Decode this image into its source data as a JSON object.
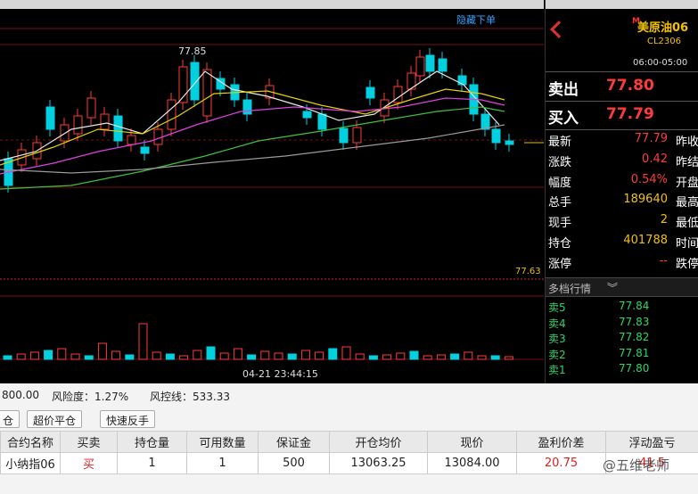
{
  "chart": {
    "hide_panel_label": "隐藏下单",
    "high_label": "77.85",
    "current_price_label": "77.63",
    "time_label": "04-21 23:44:15"
  },
  "quote": {
    "name": "美原油06",
    "code": "CL2306",
    "badge": "M",
    "session": "06:00-05:00",
    "sell_label": "卖出",
    "sell_price": "77.80",
    "buy_label": "买入",
    "buy_price": "77.79",
    "rows": [
      {
        "label": "最新",
        "value": "77.79",
        "right": "昨收",
        "color": "#ff3a3a"
      },
      {
        "label": "涨跌",
        "value": "0.42",
        "right": "昨结",
        "color": "#ff3a3a"
      },
      {
        "label": "幅度",
        "value": "0.54%",
        "right": "开盘",
        "color": "#ff3a3a"
      },
      {
        "label": "总手",
        "value": "189640",
        "right": "最高",
        "color": "#f2c200"
      },
      {
        "label": "现手",
        "value": "2",
        "right": "最低",
        "color": "#f2c200"
      },
      {
        "label": "持仓",
        "value": "401788",
        "right": "时间",
        "color": "#f2c200"
      },
      {
        "label": "涨停",
        "value": "--",
        "right": "跌停",
        "color": "#ff3a3a"
      }
    ],
    "depth_title": "多档行情",
    "depth_icon": "chevron-double-down-icon",
    "depth": [
      {
        "label": "卖5",
        "value": "77.84"
      },
      {
        "label": "卖4",
        "value": "77.83"
      },
      {
        "label": "卖3",
        "value": "77.82"
      },
      {
        "label": "卖2",
        "value": "77.81"
      },
      {
        "label": "卖1",
        "value": "77.80"
      }
    ]
  },
  "account": {
    "balance_tail": "800.00",
    "risk_label": "风险度：1.27%",
    "control_label": "风控线：533.33",
    "buttons": [
      "仓",
      "超价平仓",
      "快速反手"
    ],
    "table": {
      "headers": [
        "合约名称",
        "买卖",
        "持仓量",
        "可用数量",
        "保证金",
        "开仓均价",
        "现价",
        "盈利价差",
        "浮动盈亏"
      ],
      "rows": [
        [
          "小纳指06",
          "买",
          "1",
          "1",
          "500",
          "13063.25",
          "13084.00",
          "20.75",
          "41.5"
        ]
      ]
    },
    "watermark": "@五维老师"
  },
  "colors": {
    "up": "#ff3a3a",
    "down": "#00d0e0",
    "sell_price": "#ff3a3a",
    "depth": "#29d66b",
    "accent_yellow": "#f2c200"
  }
}
